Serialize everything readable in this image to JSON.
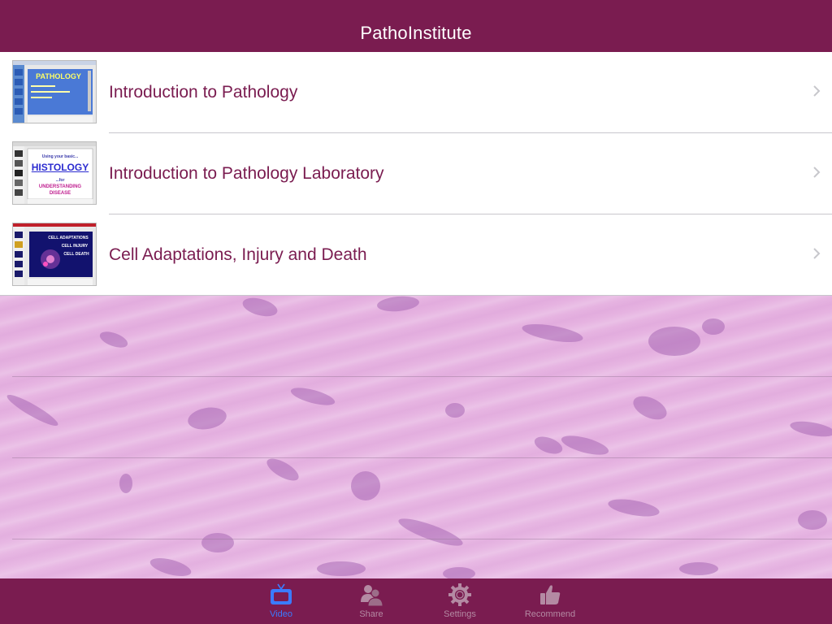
{
  "app": {
    "title": "PathoInstitute"
  },
  "videos": [
    {
      "title": "Introduction to Pathology",
      "thumb_heading": "PATHOLOGY"
    },
    {
      "title": "Introduction to Pathology Laboratory",
      "thumb_heading": "HISTOLOGY",
      "thumb_sub1": "Using your basic...",
      "thumb_sub2": "...for",
      "thumb_sub3": "UNDERSTANDING",
      "thumb_sub4": "DISEASE"
    },
    {
      "title": "Cell Adaptations, Injury and Death",
      "thumb_line1": "CELL ADAPTATIONS",
      "thumb_line2": "CELL INJURY",
      "thumb_line3": "CELL DEATH"
    }
  ],
  "tabs": [
    {
      "label": "Video",
      "icon": "tv-icon",
      "active": true
    },
    {
      "label": "Share",
      "icon": "people-icon",
      "active": false
    },
    {
      "label": "Settings",
      "icon": "gear-icon",
      "active": false
    },
    {
      "label": "Recommend",
      "icon": "thumbs-up-icon",
      "active": false
    }
  ],
  "colors": {
    "brand": "#7a1c50",
    "active_tab": "#3b7bff",
    "inactive_tab": "#b48aa3"
  }
}
